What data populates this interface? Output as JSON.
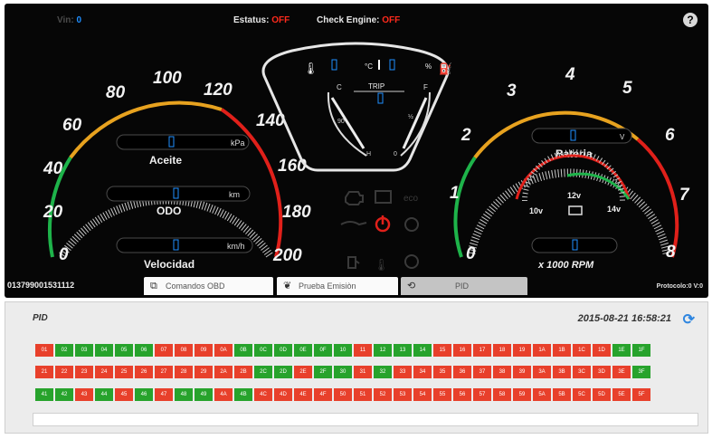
{
  "header": {
    "vin_label": "Vin:",
    "vin_value": "0",
    "status_label": "Estatus:",
    "status_value": "OFF",
    "check_engine_label": "Check Engine:",
    "check_engine_value": "OFF",
    "help_label": "?"
  },
  "speedometer": {
    "ticks": [
      "0",
      "20",
      "40",
      "60",
      "80",
      "100",
      "120",
      "140",
      "160",
      "180",
      "200"
    ],
    "readouts": [
      {
        "value": "0",
        "unit": "kPa",
        "label": "Aceite"
      },
      {
        "value": "0",
        "unit": "km",
        "label": "ODO"
      },
      {
        "value": "0",
        "unit": "km/h",
        "label": "Velocidad"
      }
    ]
  },
  "center": {
    "temp_value": "0",
    "temp_unit": "°C",
    "fuel_value": "0",
    "fuel_unit": "%",
    "trip_label": "TRIP",
    "trip_value": "0",
    "temp_low": "C",
    "temp_mid": "90",
    "temp_high": "H",
    "fuel_high": "F",
    "fuel_mid": "½",
    "fuel_low": "0",
    "eco_label": "eco"
  },
  "tachometer": {
    "ticks": [
      "0",
      "1",
      "2",
      "3",
      "4",
      "5",
      "6",
      "7",
      "8"
    ],
    "battery_value": "0",
    "battery_unit": "V",
    "battery_label": "Bateria",
    "volt_low": "10v",
    "volt_mid": "12v",
    "volt_high": "14v",
    "rpm_value": "0",
    "rpm_label": "x 1000 RPM"
  },
  "footer": {
    "serial": "013799001531112",
    "protocol": "Protocolo:0   V:0"
  },
  "tabs": [
    {
      "label": "Comandos OBD",
      "icon": "obd-icon",
      "active": false
    },
    {
      "label": "Prueba Emisiòn",
      "icon": "leaf-icon",
      "active": false
    },
    {
      "label": "PID",
      "icon": "engine-icon",
      "active": true
    }
  ],
  "pid": {
    "title": "PID",
    "datetime": "2015-08-21 16:58:21",
    "rows": [
      {
        "codes": [
          "01",
          "02",
          "03",
          "04",
          "05",
          "06",
          "07",
          "08",
          "09",
          "0A",
          "0B",
          "0C",
          "0D",
          "0E",
          "0F",
          "10",
          "11",
          "12",
          "13",
          "14",
          "15",
          "16",
          "17",
          "18",
          "19",
          "1A",
          "1B",
          "1C",
          "1D",
          "1E",
          "1F"
        ],
        "states": [
          0,
          1,
          1,
          1,
          1,
          1,
          0,
          0,
          0,
          0,
          1,
          1,
          1,
          1,
          1,
          1,
          0,
          1,
          1,
          1,
          0,
          0,
          0,
          0,
          0,
          0,
          0,
          0,
          0,
          1,
          1
        ]
      },
      {
        "codes": [
          "21",
          "22",
          "23",
          "24",
          "25",
          "26",
          "27",
          "28",
          "29",
          "2A",
          "2B",
          "2C",
          "2D",
          "2E",
          "2F",
          "30",
          "31",
          "32",
          "33",
          "34",
          "35",
          "36",
          "37",
          "38",
          "39",
          "3A",
          "3B",
          "3C",
          "3D",
          "3E",
          "3F"
        ],
        "states": [
          0,
          0,
          0,
          0,
          0,
          0,
          0,
          0,
          0,
          0,
          0,
          1,
          1,
          0,
          1,
          1,
          0,
          1,
          0,
          0,
          0,
          0,
          0,
          0,
          0,
          0,
          0,
          0,
          0,
          0,
          1
        ]
      },
      {
        "codes": [
          "41",
          "42",
          "43",
          "44",
          "45",
          "46",
          "47",
          "48",
          "49",
          "4A",
          "4B",
          "4C",
          "4D",
          "4E",
          "4F",
          "50",
          "51",
          "52",
          "53",
          "54",
          "55",
          "56",
          "57",
          "58",
          "59",
          "5A",
          "5B",
          "5C",
          "5D",
          "5E",
          "5F"
        ],
        "states": [
          1,
          1,
          0,
          1,
          0,
          1,
          0,
          1,
          1,
          0,
          1,
          0,
          0,
          0,
          0,
          0,
          0,
          0,
          0,
          0,
          0,
          0,
          0,
          0,
          0,
          0,
          0,
          0,
          0,
          0,
          0
        ]
      }
    ],
    "colors": {
      "supported": "#27a32c",
      "unsupported": "#e8402b"
    }
  },
  "colors": {
    "dash_bg": "#060606",
    "accent_blue": "#1f8fff",
    "alert_red": "#ff2a1c"
  }
}
